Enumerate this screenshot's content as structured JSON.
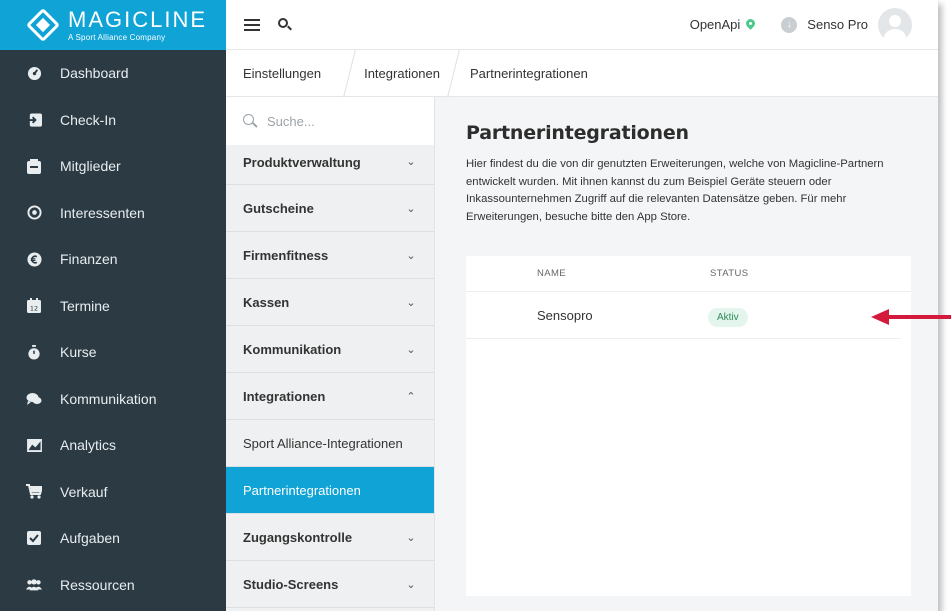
{
  "brand": {
    "name": "MAGICLINE",
    "tagline": "A Sport Alliance Company",
    "accent": "#0fa3d6",
    "nav_bg": "#2b3a43"
  },
  "nav": {
    "items": [
      {
        "label": "Dashboard",
        "icon": "dashboard-icon"
      },
      {
        "label": "Check-In",
        "icon": "checkin-icon"
      },
      {
        "label": "Mitglieder",
        "icon": "members-icon"
      },
      {
        "label": "Interessenten",
        "icon": "target-icon"
      },
      {
        "label": "Finanzen",
        "icon": "euro-icon"
      },
      {
        "label": "Termine",
        "icon": "calendar-icon"
      },
      {
        "label": "Kurse",
        "icon": "stopwatch-icon"
      },
      {
        "label": "Kommunikation",
        "icon": "chat-icon"
      },
      {
        "label": "Analytics",
        "icon": "chart-icon"
      },
      {
        "label": "Verkauf",
        "icon": "cart-icon"
      },
      {
        "label": "Aufgaben",
        "icon": "checkbox-icon"
      },
      {
        "label": "Ressourcen",
        "icon": "people-icon"
      }
    ]
  },
  "topbar": {
    "openapi_label": "OpenApi",
    "user_name": "Senso Pro",
    "status_color": "#4cc98d"
  },
  "breadcrumb": {
    "items": [
      "Einstellungen",
      "Integrationen",
      "Partnerintegrationen"
    ]
  },
  "settings_nav": {
    "search_placeholder": "Suche...",
    "sections": [
      {
        "label": "Produktverwaltung",
        "expanded": false
      },
      {
        "label": "Gutscheine",
        "expanded": false
      },
      {
        "label": "Firmenfitness",
        "expanded": false
      },
      {
        "label": "Kassen",
        "expanded": false
      },
      {
        "label": "Kommunikation",
        "expanded": false
      },
      {
        "label": "Integrationen",
        "expanded": true,
        "children": [
          "Sport Alliance-Integrationen",
          "Partnerintegrationen"
        ]
      },
      {
        "label": "Zugangskontrolle",
        "expanded": false
      },
      {
        "label": "Studio-Screens",
        "expanded": false
      }
    ],
    "active_child": "Partnerintegrationen"
  },
  "main": {
    "title": "Partnerintegrationen",
    "description": "Hier findest du die von dir genutzten Erweiterungen, welche von Magicline-Partnern entwickelt wurden. Mit ihnen kannst du zum Beispiel Geräte steuern oder Inkassounternehmen Zugriff auf die relevanten Datensätze geben. Für mehr Erweiterungen, besuche bitte den App Store.",
    "table": {
      "columns": [
        "NAME",
        "STATUS"
      ],
      "rows": [
        {
          "name": "Sensopro",
          "status": "Aktiv"
        }
      ]
    }
  },
  "annotation": {
    "arrow_color": "#d41a3c"
  }
}
